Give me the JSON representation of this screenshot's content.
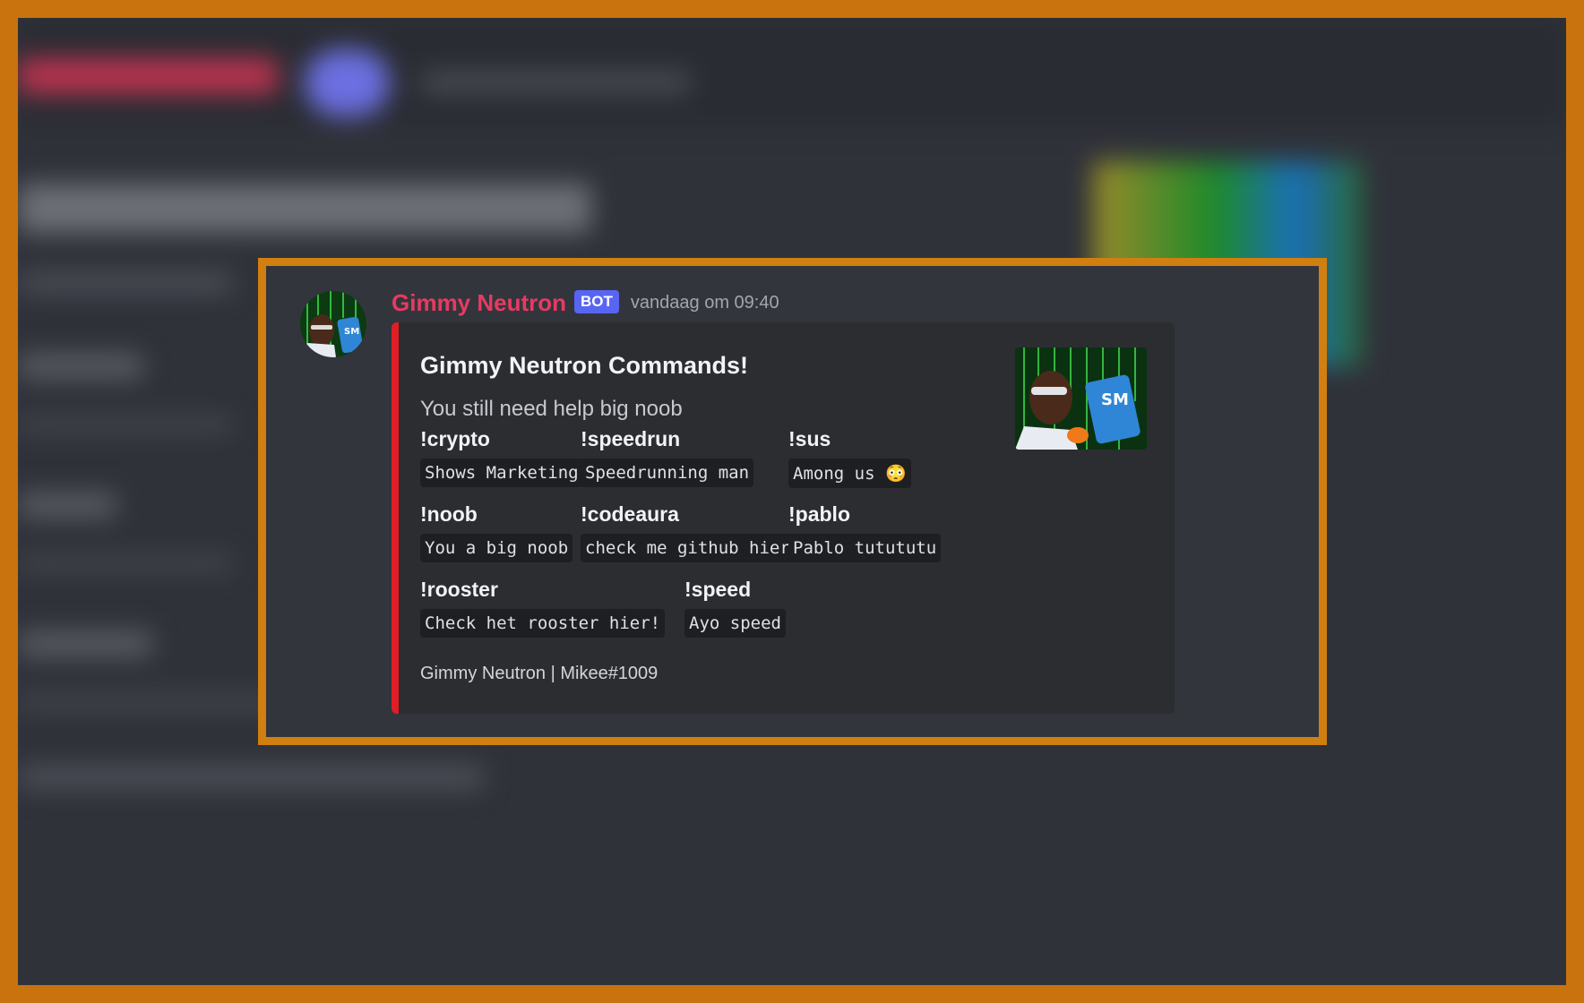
{
  "message": {
    "username": "Gimmy Neutron",
    "badge": "BOT",
    "timestamp": "vandaag om 09:40",
    "avatar_icon": "bot-avatar-icon"
  },
  "embed": {
    "accent_color": "#e01e26",
    "title": "Gimmy Neutron Commands!",
    "description": "You still need help big noob",
    "thumbnail_icon": "bot-thumbnail-icon",
    "fields": [
      {
        "name": "!crypto",
        "value": "Shows Marketing"
      },
      {
        "name": "!speedrun",
        "value": "Speedrunning man"
      },
      {
        "name": "!sus",
        "value": "Among us 😳"
      },
      {
        "name": "!noob",
        "value": "You a big noob"
      },
      {
        "name": "!codeaura",
        "value": "check me github hier"
      },
      {
        "name": "!pablo",
        "value": "Pablo tutututu"
      },
      {
        "name": "!rooster",
        "value": "Check het rooster hier!"
      },
      {
        "name": "!speed",
        "value": "Ayo speed"
      }
    ],
    "footer": "Gimmy Neutron | Mikee#1009"
  },
  "colors": {
    "frame": "#d07f10",
    "username": "#e63b62",
    "badge": "#5865f2"
  }
}
